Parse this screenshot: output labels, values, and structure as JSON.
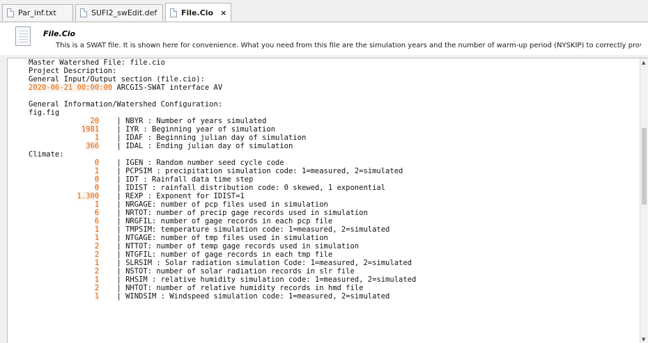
{
  "tabs": [
    {
      "label": "Par_inf.txt"
    },
    {
      "label": "SUFI2_swEdit.def"
    },
    {
      "label": "File.Cio",
      "close": "×"
    }
  ],
  "header": {
    "title": "File.Cio",
    "description": "This is a SWAT file. It is shown here for convenience. What you need from this file are the simulation years and the number of warm-up period (NYSKIP) to correctly provide SWAT-CUP With ..."
  },
  "editor": {
    "lines": [
      {
        "text": "Master Watershed File: file.cio"
      },
      {
        "text": "Project Description:"
      },
      {
        "text": "General Input/Output section (file.cio):"
      },
      {
        "num": "2020-06-21 00:00:00",
        "text": " ARCGIS-SWAT interface AV"
      },
      {
        "text": ""
      },
      {
        "text": "General Information/Watershed Configuration:"
      },
      {
        "text": "fig.fig"
      },
      {
        "pad": "              ",
        "num": "20",
        "text": "    | NBYR : Number of years simulated"
      },
      {
        "pad": "            ",
        "num": "1981",
        "text": "    | IYR : Beginning year of simulation"
      },
      {
        "pad": "               ",
        "num": "1",
        "text": "    | IDAF : Beginning julian day of simulation"
      },
      {
        "pad": "             ",
        "num": "366",
        "text": "    | IDAL : Ending julian day of simulation"
      },
      {
        "text": "Climate:"
      },
      {
        "pad": "               ",
        "num": "0",
        "text": "    | IGEN : Random number seed cycle code"
      },
      {
        "pad": "               ",
        "num": "1",
        "text": "    | PCPSIM : precipitation simulation code: 1=measured, 2=simulated"
      },
      {
        "pad": "               ",
        "num": "0",
        "text": "    | IDT : Rainfall data time step"
      },
      {
        "pad": "               ",
        "num": "0",
        "text": "    | IDIST : rainfall distribution code: 0 skewed, 1 exponential"
      },
      {
        "pad": "           ",
        "num": "1.300",
        "text": "    | REXP : Exponent for IDIST=1"
      },
      {
        "pad": "               ",
        "num": "1",
        "text": "    | NRGAGE: number of pcp files used in simulation"
      },
      {
        "pad": "               ",
        "num": "6",
        "text": "    | NRTOT: number of precip gage records used in simulation"
      },
      {
        "pad": "               ",
        "num": "6",
        "text": "    | NRGFIL: number of gage records in each pcp file"
      },
      {
        "pad": "               ",
        "num": "1",
        "text": "    | TMPSIM: temperature simulation code: 1=measured, 2=simulated"
      },
      {
        "pad": "               ",
        "num": "1",
        "text": "    | NTGAGE: number of tmp files used in simulation"
      },
      {
        "pad": "               ",
        "num": "2",
        "text": "    | NTTOT: number of temp gage records used in simulation"
      },
      {
        "pad": "               ",
        "num": "2",
        "text": "    | NTGFIL: number of gage records in each tmp file"
      },
      {
        "pad": "               ",
        "num": "1",
        "text": "    | SLRSIM : Solar radiation simulation Code: 1=measured, 2=simulated"
      },
      {
        "pad": "               ",
        "num": "2",
        "text": "    | NSTOT: number of solar radiation records in slr file"
      },
      {
        "pad": "               ",
        "num": "1",
        "text": "    | RHSIM : relative humidity simulation code: 1=measured, 2=simulated"
      },
      {
        "pad": "               ",
        "num": "2",
        "text": "    | NHTOT: number of relative humidity records in hmd file"
      },
      {
        "pad": "               ",
        "num": "1",
        "text": "    | WINDSIM : Windspeed simulation code: 1=measured, 2=simulated"
      }
    ]
  },
  "colors": {
    "number": "#e06000",
    "text": "#111111",
    "background": "#ffffff"
  }
}
